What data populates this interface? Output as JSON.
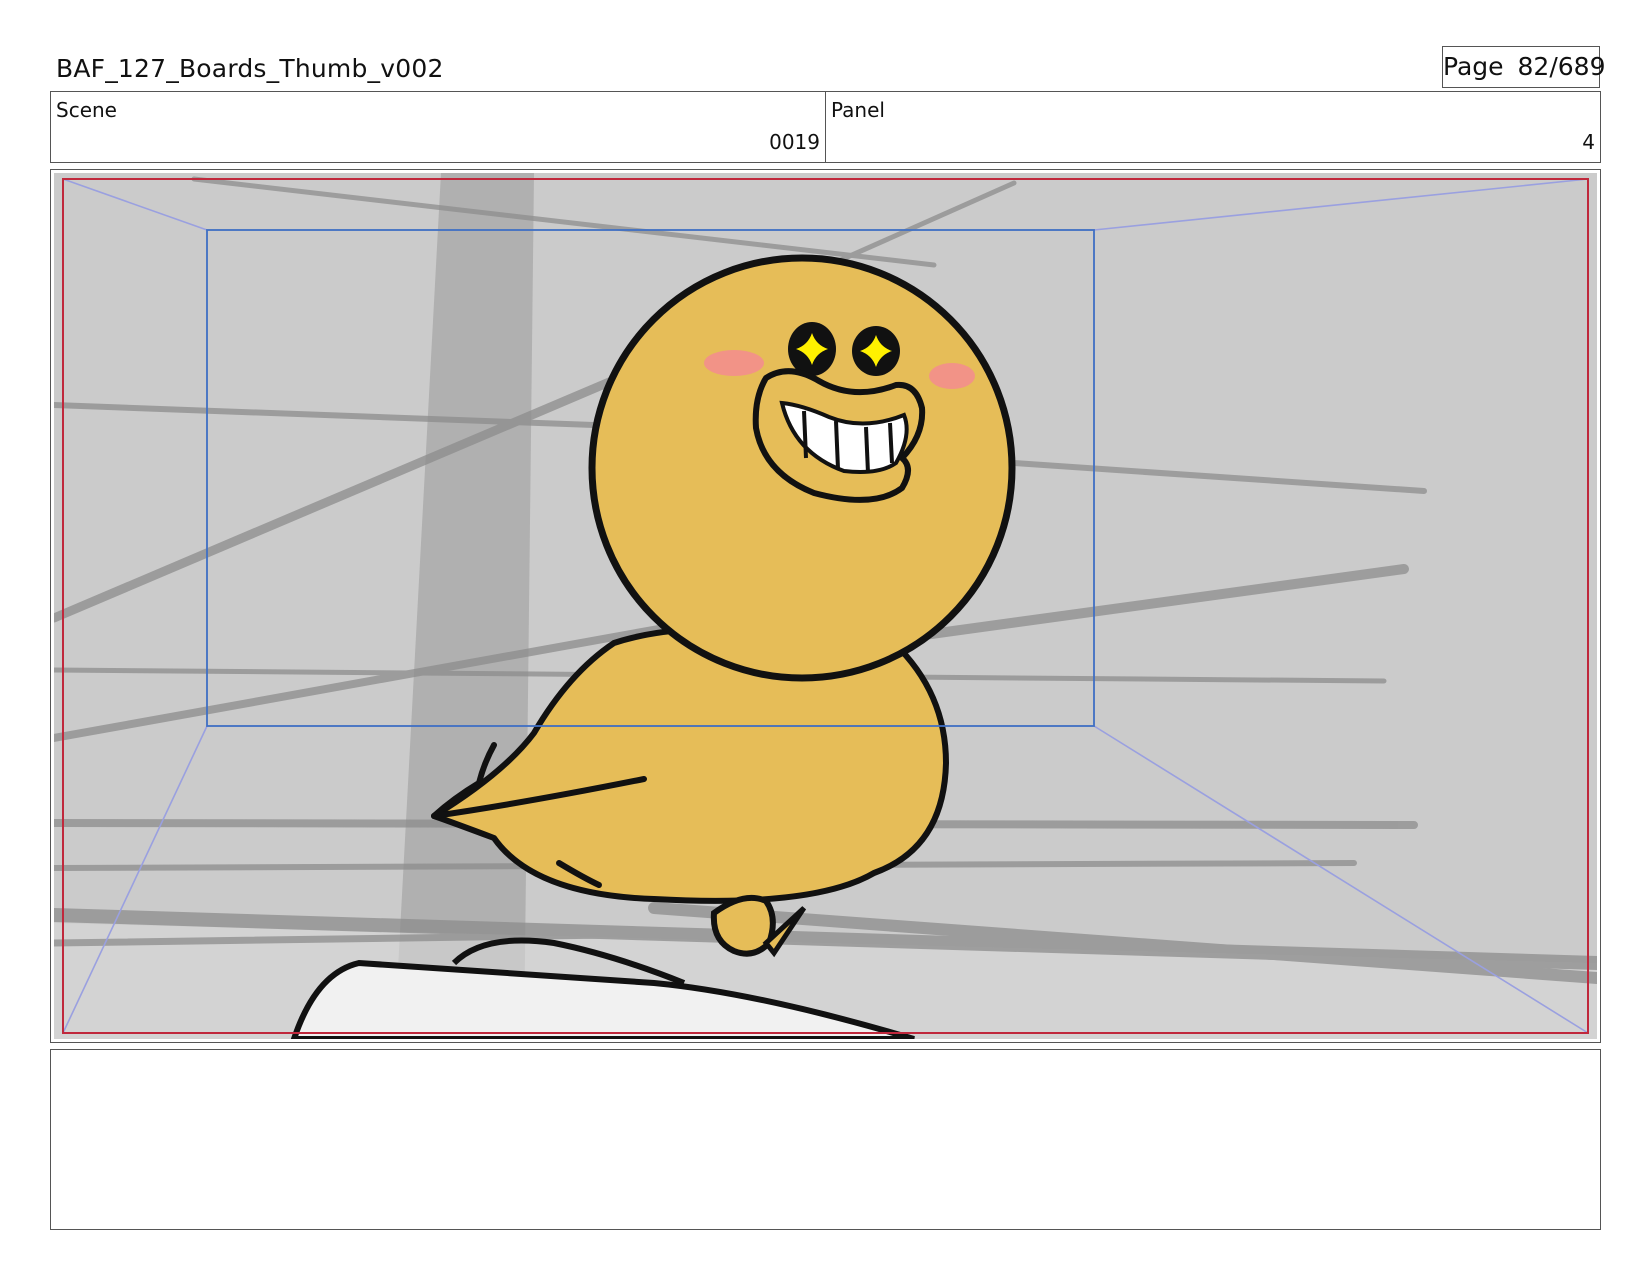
{
  "header": {
    "title": "BAF_127_Boards_Thumb_v002",
    "page_word": "Page",
    "page_number": "82/689"
  },
  "meta": {
    "scene_label": "Scene",
    "scene_value": "0019",
    "panel_label": "Panel",
    "panel_value": "4"
  },
  "panel_image": {
    "subject": "smiling yellow bird character with sparkle eyes",
    "colors": {
      "background": "#cbcbcb",
      "bird_body": "#e6bd58",
      "outline": "#111111",
      "eye_sparkle": "#fff000",
      "blush": "#f2908a",
      "safe_frame": "#3f6fc4",
      "field_frame": "#c0283c",
      "guide_lines": "#9aa0e0"
    }
  },
  "notes": {
    "text": ""
  }
}
